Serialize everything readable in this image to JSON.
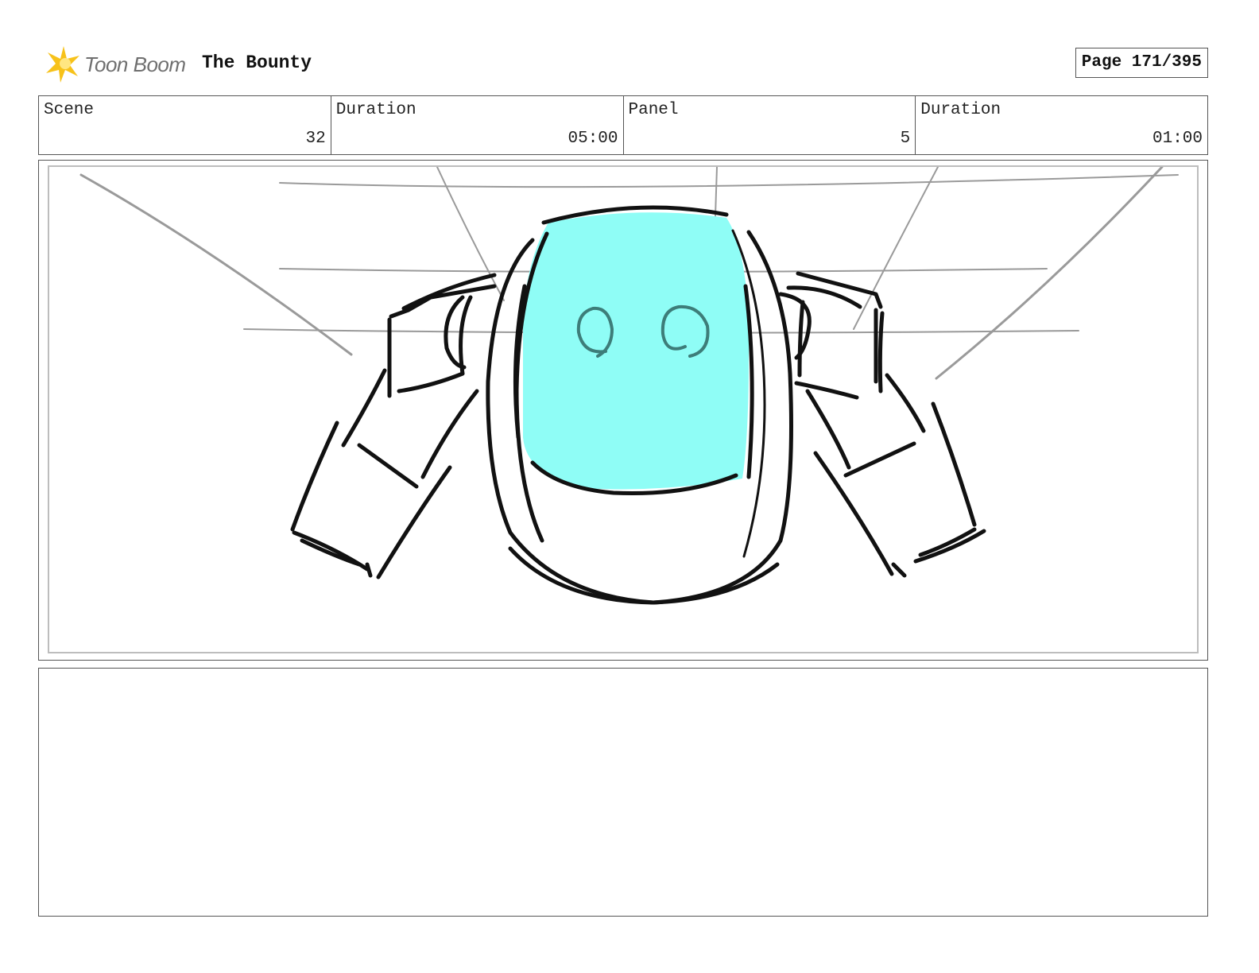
{
  "header": {
    "logo_text": "Toon Boom",
    "project_title": "The Bounty",
    "page_indicator": "Page 171/395"
  },
  "info": {
    "scene_label": "Scene",
    "scene_value": "32",
    "scene_duration_label": "Duration",
    "scene_duration_value": "05:00",
    "panel_label": "Panel",
    "panel_value": "5",
    "panel_duration_label": "Duration",
    "panel_duration_value": "01:00"
  },
  "colors": {
    "logo_star": "#f7c21a",
    "screen_fill": "#8ffdf6",
    "eye_stroke": "#3d7d79",
    "sketch_line": "#111111",
    "guide_line": "#9a9a9a",
    "border": "#555555"
  },
  "sketch": {
    "subject": "robot-head-front-view"
  },
  "notes": {
    "text": ""
  }
}
